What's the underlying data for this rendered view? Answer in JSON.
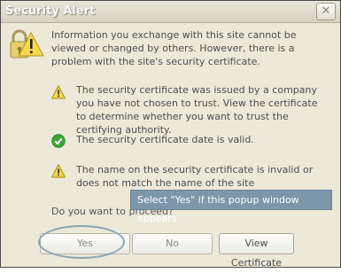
{
  "window": {
    "title": "Security Alert",
    "close_glyph": "✕"
  },
  "intro": "Information you exchange with this site cannot be viewed or changed by others. However, there is a problem with the site's security certificate.",
  "messages": [
    {
      "icon": "warning-icon",
      "text": "The security certificate was issued by a company you have not chosen to trust. View the certificate to determine whether you want to trust the certifying authority."
    },
    {
      "icon": "check-icon",
      "text": "The security certificate date is valid."
    },
    {
      "icon": "warning-icon",
      "text": "The name on the security certificate is invalid or does not match the name of the site"
    }
  ],
  "question": "Do you want to proceed?",
  "tooltip": "Select \"Yes\" if this popup window appears",
  "buttons": {
    "yes": "Yes",
    "no": "No",
    "view": "View Certificate"
  },
  "colors": {
    "dialog_bg": "#ece9d8",
    "tooltip_bg": "#7c96aa",
    "highlight_oval": "#8aa4b4",
    "warning": "#f6d74a",
    "check": "#3aa635"
  }
}
